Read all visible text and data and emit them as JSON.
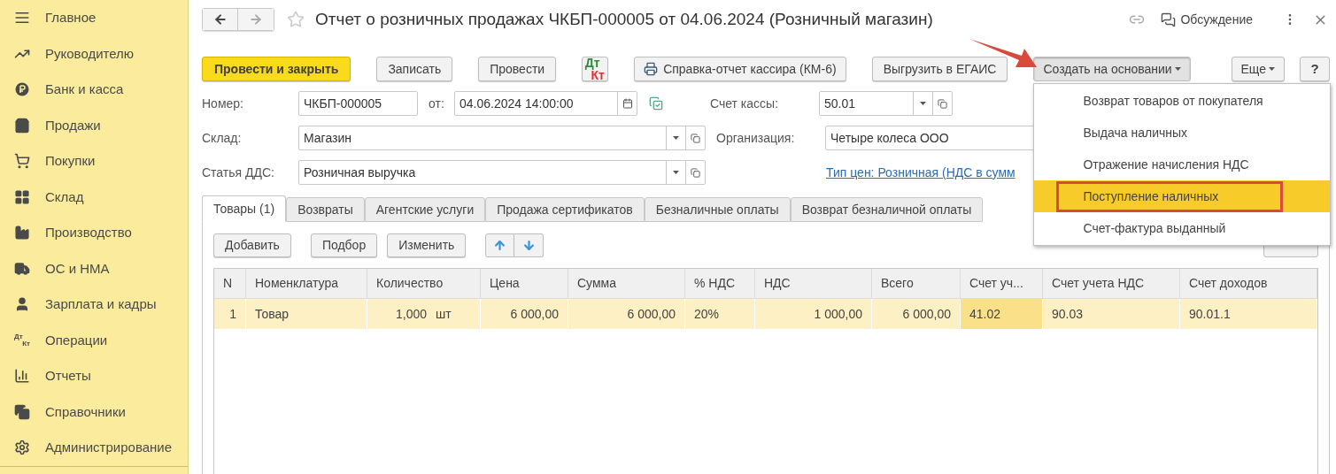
{
  "sidebar": {
    "items": [
      {
        "label": "Главное",
        "selected": false
      },
      {
        "label": "Руководителю",
        "selected": false
      },
      {
        "label": "Банк и касса",
        "selected": false
      },
      {
        "label": "Продажи",
        "selected": false
      },
      {
        "label": "Покупки",
        "selected": false
      },
      {
        "label": "Склад",
        "selected": false
      },
      {
        "label": "Производство",
        "selected": false
      },
      {
        "label": "ОС и НМА",
        "selected": false
      },
      {
        "label": "Зарплата и кадры",
        "selected": false
      },
      {
        "label": "Операции",
        "selected": false,
        "icon_text": [
          "Дт",
          "Кт"
        ]
      },
      {
        "label": "Отчеты",
        "selected": false
      },
      {
        "label": "Справочники",
        "selected": false
      },
      {
        "label": "Администрирование",
        "selected": false
      }
    ]
  },
  "window": {
    "title": "Отчет о розничных продажах ЧКБП-000005 от 04.06.2024 (Розничный магазин)",
    "discussion": "Обсуждение"
  },
  "toolbar": [
    {
      "kind": "primary",
      "label": "Провести и закрыть"
    },
    {
      "kind": "default",
      "label": "Записать"
    },
    {
      "kind": "default",
      "label": "Провести"
    },
    {
      "kind": "dtkt",
      "texts": [
        "Дт",
        "Кт"
      ]
    },
    {
      "kind": "print",
      "label": "Справка-отчет кассира (КМ-6)"
    },
    {
      "kind": "default",
      "label": "Выгрузить в ЕГАИС"
    },
    {
      "kind": "dropdown",
      "label": "Создать на основании",
      "pressed": true
    },
    {
      "kind": "dropdown",
      "label": "Еще",
      "pressed": false
    },
    {
      "kind": "help",
      "label": "?"
    }
  ],
  "form": {
    "number_label": "Номер:",
    "number": "ЧКБП-000005",
    "date_label": "от:",
    "date": "04.06.2024 14:00:00",
    "cash_account_label": "Счет кассы:",
    "cash_account": "50.01",
    "warehouse_label": "Склад:",
    "warehouse": "Магазин",
    "organization_label": "Организация:",
    "organization": "Четыре колеса ООО",
    "dds_label": "Статья ДДС:",
    "dds": "Розничная выручка",
    "price_type_link": "Тип цен: Розничная (НДС в сумм"
  },
  "tabs": [
    {
      "label": "Товары (1)",
      "selected": true
    },
    {
      "label": "Возвраты",
      "selected": false
    },
    {
      "label": "Агентские услуги",
      "selected": false
    },
    {
      "label": "Продажа сертификатов",
      "selected": false
    },
    {
      "label": "Безналичные оплаты",
      "selected": false
    },
    {
      "label": "Возврат безналичной оплаты",
      "selected": false
    }
  ],
  "table_toolbar": {
    "buttons": [
      "Добавить",
      "Подбор",
      "Изменить"
    ]
  },
  "table": {
    "columns": [
      "N",
      "Номенклатура",
      "Количество",
      "Цена",
      "Сумма",
      "% НДС",
      "НДС",
      "Всего",
      "Счет уч...",
      "Счет учета НДС",
      "Счет доходов"
    ],
    "rows": [
      {
        "selected": true,
        "cells": [
          {
            "text": "1",
            "selected": false
          },
          {
            "text": "Товар",
            "selected": false
          },
          {
            "text": "1,000",
            "unit": "шт",
            "selected": false
          },
          {
            "text": "6 000,00",
            "selected": false
          },
          {
            "text": "6 000,00",
            "selected": false
          },
          {
            "text": "20%",
            "selected": false
          },
          {
            "text": "1 000,00",
            "selected": false
          },
          {
            "text": "6 000,00",
            "selected": false
          },
          {
            "text": "41.02",
            "selected": true
          },
          {
            "text": "90.03",
            "selected": false
          },
          {
            "text": "90.01.1",
            "selected": false
          }
        ]
      }
    ]
  },
  "create_menu": {
    "items": [
      {
        "label": "Возврат товаров от покупателя",
        "selected": false
      },
      {
        "label": "Выдача наличных",
        "selected": false
      },
      {
        "label": "Отражение начисления НДС",
        "selected": false
      },
      {
        "label": "Поступление наличных",
        "selected": true
      },
      {
        "label": "Счет-фактура выданный",
        "selected": false
      }
    ]
  }
}
